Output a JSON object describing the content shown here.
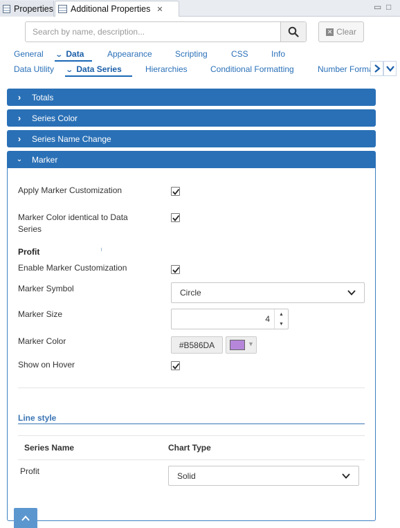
{
  "window": {
    "tabs": [
      {
        "label": "Properties",
        "active": false
      },
      {
        "label": "Additional Properties",
        "active": true
      }
    ],
    "minimize_glyph": "▭",
    "maximize_glyph": "□"
  },
  "search": {
    "placeholder": "Search by name, description...",
    "value": "",
    "clear_label": "Clear"
  },
  "nav_primary": [
    {
      "label": "General",
      "active": false
    },
    {
      "label": "Data",
      "active": true
    },
    {
      "label": "Appearance",
      "active": false
    },
    {
      "label": "Scripting",
      "active": false
    },
    {
      "label": "CSS",
      "active": false
    },
    {
      "label": "Info",
      "active": false
    }
  ],
  "nav_secondary": [
    {
      "label": "Data Utility",
      "active": false
    },
    {
      "label": "Data Series",
      "active": true
    },
    {
      "label": "Hierarchies",
      "active": false
    },
    {
      "label": "Conditional Formatting",
      "active": false
    },
    {
      "label": "Number Forma",
      "active": false
    }
  ],
  "accordion": [
    {
      "label": "Totals",
      "expanded": false
    },
    {
      "label": "Series Color",
      "expanded": false
    },
    {
      "label": "Series Name Change",
      "expanded": false
    },
    {
      "label": "Marker",
      "expanded": true
    }
  ],
  "marker": {
    "apply_label": "Apply Marker Customization",
    "apply_checked": true,
    "identical_label_line1": "Marker Color identical to Data",
    "identical_label_line2": "Series",
    "identical_checked": true,
    "series_heading": "Profit",
    "enable_label": "Enable Marker Customization",
    "enable_checked": true,
    "symbol_label": "Marker Symbol",
    "symbol_value": "Circle",
    "size_label": "Marker Size",
    "size_value": "4",
    "color_label": "Marker Color",
    "color_hex": "#B586DA",
    "hover_label": "Show on Hover",
    "hover_checked": true
  },
  "line_style": {
    "title": "Line style",
    "col_series": "Series Name",
    "col_chart": "Chart Type",
    "rows": [
      {
        "series": "Profit",
        "chart_type": "Solid"
      }
    ]
  },
  "colors": {
    "accent": "#2a70b6",
    "link": "#2a70b8",
    "swatch": "#B586DA"
  }
}
